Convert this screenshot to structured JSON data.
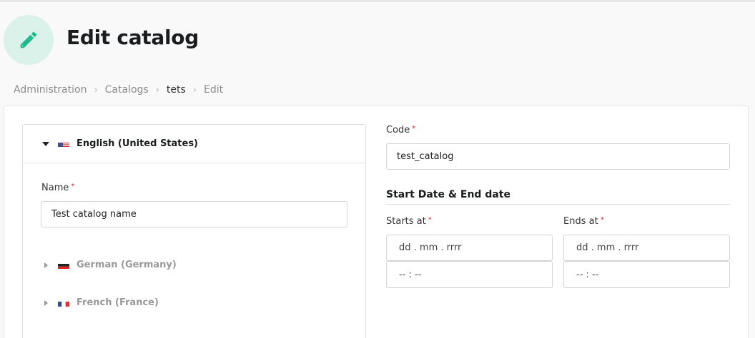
{
  "header": {
    "title": "Edit catalog",
    "icon": "pencil-icon",
    "icon_color": "#21ba8c",
    "icon_bg": "#daf2ea"
  },
  "breadcrumb": {
    "items": [
      "Administration",
      "Catalogs",
      "tets",
      "Edit"
    ]
  },
  "translations": {
    "active": {
      "label": "English (United States)",
      "name_label": "Name",
      "name_value": "Test catalog name"
    },
    "collapsed": [
      {
        "label": "German (Germany)"
      },
      {
        "label": "French (France)"
      }
    ]
  },
  "form": {
    "code_label": "Code",
    "code_value": "test_catalog",
    "dates_section_title": "Start Date & End date",
    "starts_label": "Starts at",
    "ends_label": "Ends at",
    "date_placeholder": "dd . mm . rrrr",
    "time_placeholder": "-- : --"
  },
  "colors": {
    "required": "#db2828",
    "accent": "#21ba8c"
  }
}
